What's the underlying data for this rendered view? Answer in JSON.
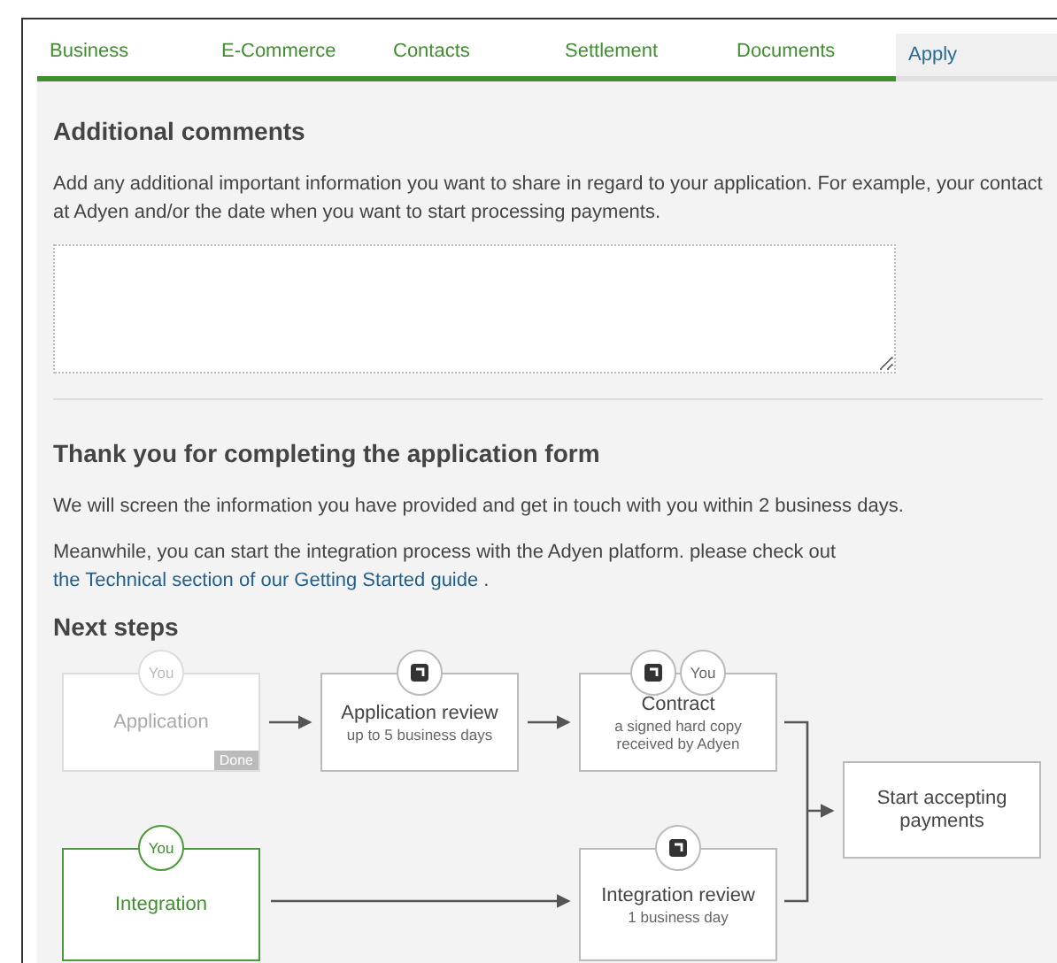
{
  "tabs": [
    {
      "label": "Business",
      "done": true,
      "selected": false
    },
    {
      "label": "E-Commerce",
      "done": true,
      "selected": false
    },
    {
      "label": "Contacts",
      "done": true,
      "selected": false
    },
    {
      "label": "Settlement",
      "done": true,
      "selected": false
    },
    {
      "label": "Documents",
      "done": true,
      "selected": false
    },
    {
      "label": "Apply",
      "done": false,
      "selected": true
    }
  ],
  "additional_comments": {
    "heading": "Additional comments",
    "description": "Add any additional important information you want to share in regard to your application. For example, your contact at Adyen and/or the date when you want to start processing payments."
  },
  "confirmation": {
    "heading": "Thank you for completing the application form",
    "paragraphs": [
      {
        "text": "We will screen the information you have provided and get in touch with you within 2 business days."
      },
      {
        "text": "Meanwhile, you can start the integration process with the Adyen platform. please check out",
        "link": "the Technical section of our Getting Started guide",
        "after": "."
      }
    ]
  },
  "next_steps": {
    "heading": "Next steps",
    "nodes": [
      {
        "title": "Application",
        "done": true,
        "active": false,
        "tag": "Done",
        "badges": [
          {
            "kind": "you",
            "label": "You"
          }
        ]
      },
      {
        "title": "Application review",
        "subtitle": "up to 5 business days",
        "done": false,
        "active": false,
        "badges": [
          {
            "kind": "adyen"
          }
        ]
      },
      {
        "title": "Contract",
        "subtitle": "a signed hard copy received by Adyen",
        "done": false,
        "active": false,
        "badges": [
          {
            "kind": "adyen"
          },
          {
            "kind": "you",
            "label": "You"
          }
        ]
      },
      {
        "title": "Start accepting payments",
        "done": false,
        "active": false
      },
      {
        "title": "Integration",
        "done": false,
        "active": true,
        "badges": [
          {
            "kind": "you",
            "label": "You"
          }
        ]
      },
      {
        "title": "Integration review",
        "subtitle": "1 business day",
        "done": false,
        "active": false,
        "badges": [
          {
            "kind": "adyen"
          }
        ]
      }
    ]
  }
}
